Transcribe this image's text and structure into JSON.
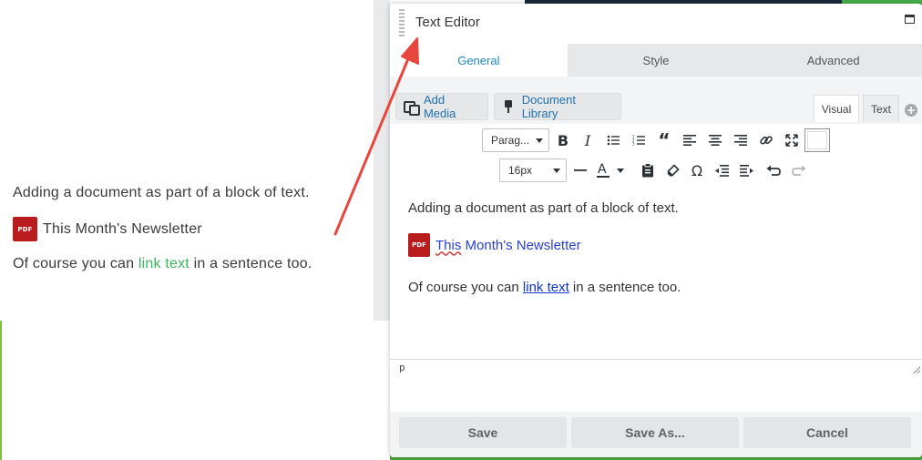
{
  "page": {
    "line1": "Adding a document as part of a block of text.",
    "doc_badge": "PDF",
    "doc_title": "This Month's Newsletter",
    "line3_before": "Of course you can ",
    "line3_link": "link text",
    "line3_after": " in a sentence too."
  },
  "panel": {
    "title": "Text Editor",
    "tabs": [
      {
        "label": "General",
        "active": true
      },
      {
        "label": "Style",
        "active": false
      },
      {
        "label": "Advanced",
        "active": false
      }
    ]
  },
  "media": {
    "add_media": "Add Media",
    "document_library": "Document Library",
    "mode_visual": "Visual",
    "mode_text": "Text"
  },
  "toolbar": {
    "format_value": "Parag...",
    "font_size_value": "16px",
    "row1_icons": [
      "bold-icon",
      "italic-icon",
      "bullet-list-icon",
      "numbered-list-icon",
      "blockquote-icon",
      "align-left-icon",
      "align-center-icon",
      "align-right-icon",
      "link-icon",
      "fullscreen-icon",
      "toolbar-toggle-icon"
    ],
    "row2_icons": [
      "horizontal-rule-icon",
      "text-color-icon",
      "paste-as-text-icon",
      "clear-formatting-icon",
      "special-character-icon",
      "outdent-icon",
      "indent-icon",
      "undo-icon",
      "redo-icon"
    ]
  },
  "editor": {
    "line1": "Adding a document as part of a block of text.",
    "doc_badge": "PDF",
    "doc_word1": "This",
    "doc_rest": " Month's Newsletter",
    "line3_before": "Of course you can ",
    "line3_link": "link text",
    "line3_after": " in a sentence too.",
    "status_path": "p"
  },
  "footer": {
    "save": "Save",
    "save_as": "Save As...",
    "cancel": "Cancel"
  },
  "colors": {
    "accent_tab": "#1f87c4",
    "page_link": "#3bb45f",
    "editor_link": "#0f34c9",
    "pdf_badge": "#b81c1c",
    "arrow": "#e8453c"
  }
}
